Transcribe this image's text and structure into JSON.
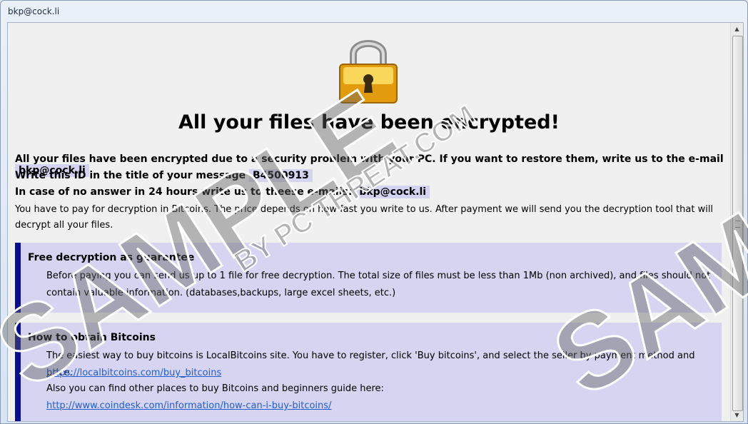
{
  "window": {
    "title": "bkp@cock.li"
  },
  "note": {
    "headline": "All your files have been encrypted!",
    "line1_text": "All your files have been encrypted due to a security problem with your PC. If you want to restore them, write us to the e-mail",
    "line1_email": "bkp@cock.li",
    "line2_text": "Write this ID in the title of your message",
    "line2_id": "B4500913",
    "line3_text": "In case of no answer in 24 hours write us to theese e-mails:",
    "line3_email": "bkp@cock.li",
    "payment_text": "You have to pay for decryption in Bitcoins. The price depends on how fast you write to us. After payment we will send you the decryption tool that will decrypt all your files."
  },
  "guarantee": {
    "title": "Free decryption as guarantee",
    "text": "Before paying you can send us up to 1 file for free decryption. The total size of files must be less than 1Mb (non archived), and files should not contain valuable information. (databases,backups, large excel sheets, etc.)"
  },
  "bitcoins": {
    "title": "How to obtain Bitcoins",
    "text1": "The easiest way to buy bitcoins is LocalBitcoins site. You have to register, click 'Buy bitcoins', and select the seller by payment method and price.",
    "link1": "https://localbitcoins.com/buy_bitcoins",
    "text2": "Also you can find other places to buy Bitcoins and beginners guide here:",
    "link2": "http://www.coindesk.com/information/how-can-i-buy-bitcoins/"
  },
  "watermark": {
    "sample": "SAMPLE",
    "byline": "BY PC THREAT.COM"
  },
  "colors": {
    "highlight": "#d4d4f2",
    "box_background": "#d6d4f0",
    "box_border": "#0a0f8c",
    "link": "#1f5fd0",
    "lock_gold": "#f2b51c"
  }
}
